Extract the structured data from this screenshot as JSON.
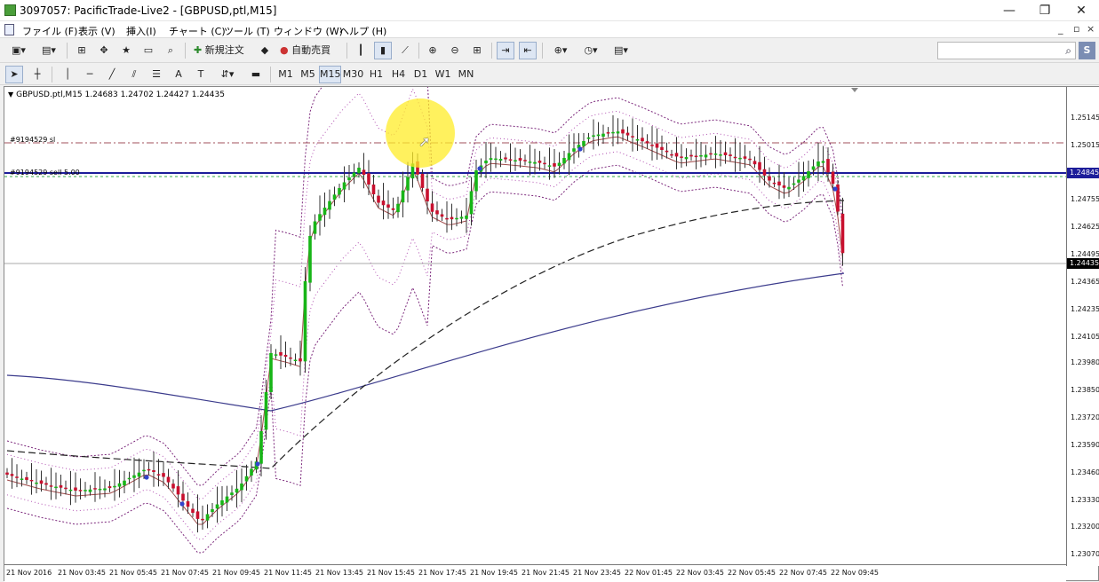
{
  "window": {
    "title": "3097057: PacificTrade-Live2 - [GBPUSD,ptl,M15]",
    "minimize": "—",
    "restore": "❐",
    "close": "✕"
  },
  "menu": {
    "items": [
      "ファイル (F)",
      "表示 (V)",
      "挿入(I)",
      "チャート (C)",
      "ツール (T)",
      "ウィンドウ (W)",
      "ヘルプ (H)"
    ],
    "mdi_min": "_",
    "mdi_restore": "▫",
    "mdi_close": "×"
  },
  "toolbar": {
    "new_order": "新規注文",
    "auto_trade": "自動売買",
    "search_placeholder": ""
  },
  "timeframes": [
    "M1",
    "M5",
    "M15",
    "M30",
    "H1",
    "H4",
    "D1",
    "W1",
    "MN"
  ],
  "active_timeframe": "M15",
  "chart": {
    "symbol_info": "GBPUSD.ptl,M15  1.24683 1.24702 1.24427 1.24435",
    "sl_line_label": "#9194529 sl",
    "sell_line_label": "#9194529 sell 5.00",
    "price_labels": [
      "1.25145",
      "1.25015",
      "1.24880",
      "1.24755",
      "1.24625",
      "1.24495",
      "1.24365",
      "1.24235",
      "1.24105",
      "1.23980",
      "1.23850",
      "1.23720",
      "1.23590",
      "1.23460",
      "1.23330",
      "1.23200",
      "1.23070"
    ],
    "price_box_position": "1.24845",
    "price_box_current": "1.24435",
    "time_labels": [
      "21 Nov 2016",
      "21 Nov 03:45",
      "21 Nov 05:45",
      "21 Nov 07:45",
      "21 Nov 09:45",
      "21 Nov 11:45",
      "21 Nov 13:45",
      "21 Nov 15:45",
      "21 Nov 17:45",
      "21 Nov 19:45",
      "21 Nov 21:45",
      "21 Nov 23:45",
      "22 Nov 01:45",
      "22 Nov 03:45",
      "22 Nov 05:45",
      "22 Nov 07:45",
      "22 Nov 09:45"
    ]
  },
  "colors": {
    "bull": "#17b517",
    "bear": "#c8102e",
    "sell_line": "#1d1d9a",
    "ma_long": "#3b3b8c",
    "band": "#7d2a7d"
  }
}
